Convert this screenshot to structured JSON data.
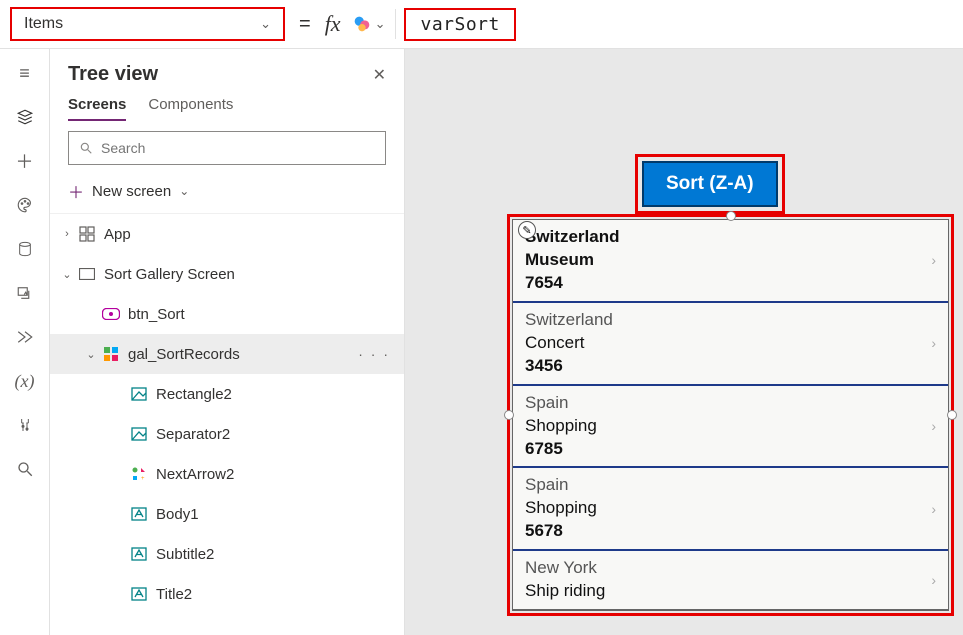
{
  "formula_bar": {
    "property": "Items",
    "value": "varSort"
  },
  "tree": {
    "title": "Tree view",
    "tabs": {
      "screens": "Screens",
      "components": "Components"
    },
    "search_placeholder": "Search",
    "new_screen": "New screen",
    "nodes": {
      "app": "App",
      "screen": "Sort Gallery Screen",
      "btn": "btn_Sort",
      "gal": "gal_SortRecords",
      "rect": "Rectangle2",
      "sep": "Separator2",
      "next": "NextArrow2",
      "body": "Body1",
      "subtitle": "Subtitle2",
      "title": "Title2"
    }
  },
  "canvas": {
    "sort_button": "Sort (Z-A)",
    "gallery": [
      {
        "country": "Switzerland",
        "activity": "Museum",
        "code": "7654"
      },
      {
        "country": "Switzerland",
        "activity": "Concert",
        "code": "3456"
      },
      {
        "country": "Spain",
        "activity": "Shopping",
        "code": "6785"
      },
      {
        "country": "Spain",
        "activity": "Shopping",
        "code": "5678"
      },
      {
        "country": "New York",
        "activity": "Ship riding",
        "code": ""
      }
    ]
  }
}
